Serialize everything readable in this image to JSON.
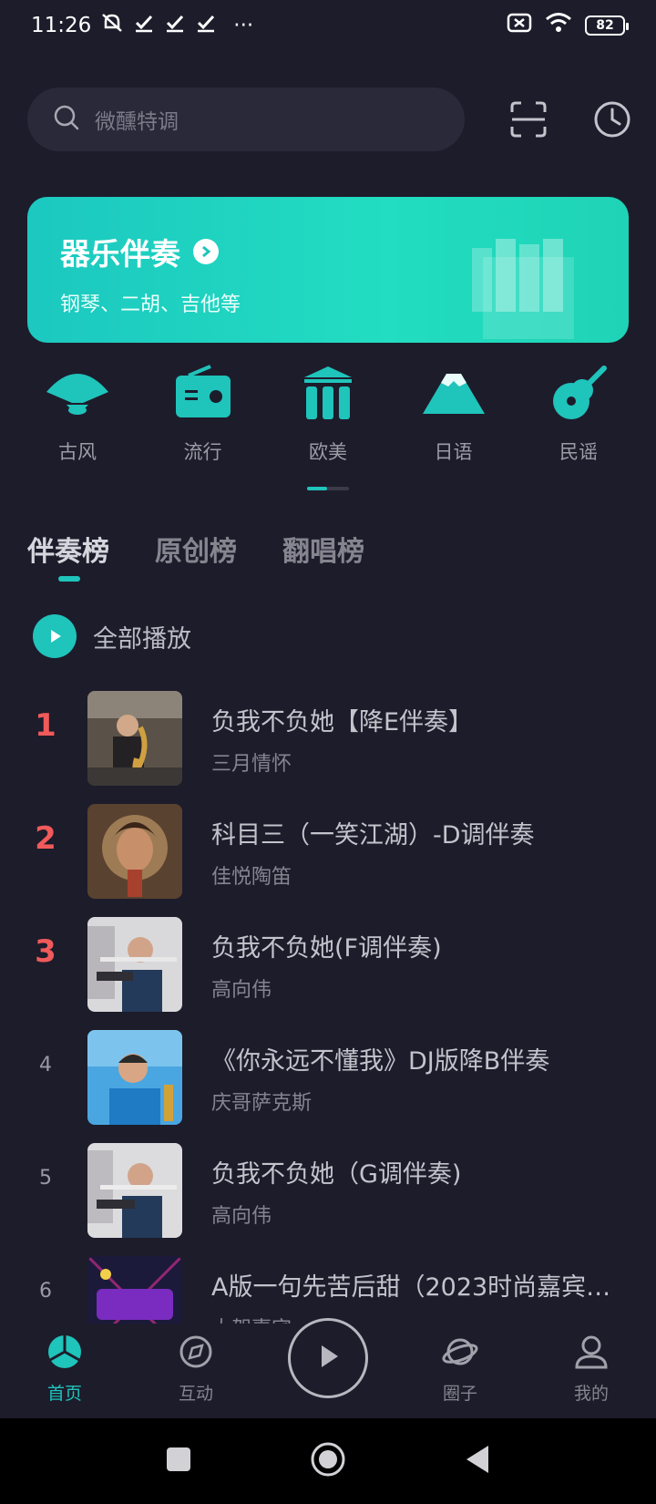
{
  "status_bar": {
    "time": "11:26",
    "extra_icons": [
      "mute-icon",
      "check-icon",
      "check-icon",
      "check-icon",
      "more-icon"
    ],
    "more_label": "···",
    "battery": "82"
  },
  "search": {
    "placeholder": "微醺特调"
  },
  "banner": {
    "title": "器乐伴奏",
    "subtitle": "钢琴、二胡、吉他等"
  },
  "categories": [
    {
      "label": "古风",
      "icon": "fan-icon"
    },
    {
      "label": "流行",
      "icon": "radio-icon"
    },
    {
      "label": "欧美",
      "icon": "columns-icon"
    },
    {
      "label": "日语",
      "icon": "mountain-icon"
    },
    {
      "label": "民谣",
      "icon": "guitar-icon"
    }
  ],
  "tabs": [
    {
      "label": "伴奏榜",
      "active": true
    },
    {
      "label": "原创榜",
      "active": false
    },
    {
      "label": "翻唱榜",
      "active": false
    }
  ],
  "play_all": {
    "label": "全部播放"
  },
  "songs": [
    {
      "rank": "1",
      "title": "负我不负她【降E伴奏】",
      "artist": "三月情怀"
    },
    {
      "rank": "2",
      "title": "科目三（一笑江湖）-D调伴奏",
      "artist": "佳悦陶笛"
    },
    {
      "rank": "3",
      "title": "负我不负她(F调伴奏)",
      "artist": "高向伟"
    },
    {
      "rank": "4",
      "title": "《你永远不懂我》DJ版降B伴奏",
      "artist": "庆哥萨克斯"
    },
    {
      "rank": "5",
      "title": "负我不负她（G调伴奏)",
      "artist": "高向伟"
    },
    {
      "rank": "6",
      "title": "A版一句先苦后甜（2023时尚嘉宾…",
      "artist": "大贺嘉宾"
    }
  ],
  "bottom_nav": [
    {
      "label": "首页",
      "active": true
    },
    {
      "label": "互动",
      "active": false
    },
    {
      "label": "圈子",
      "active": false
    },
    {
      "label": "我的",
      "active": false
    }
  ],
  "colors": {
    "accent": "#1fc4bb",
    "background": "#1d1c2b",
    "rank_highlight": "#f05a5a"
  }
}
